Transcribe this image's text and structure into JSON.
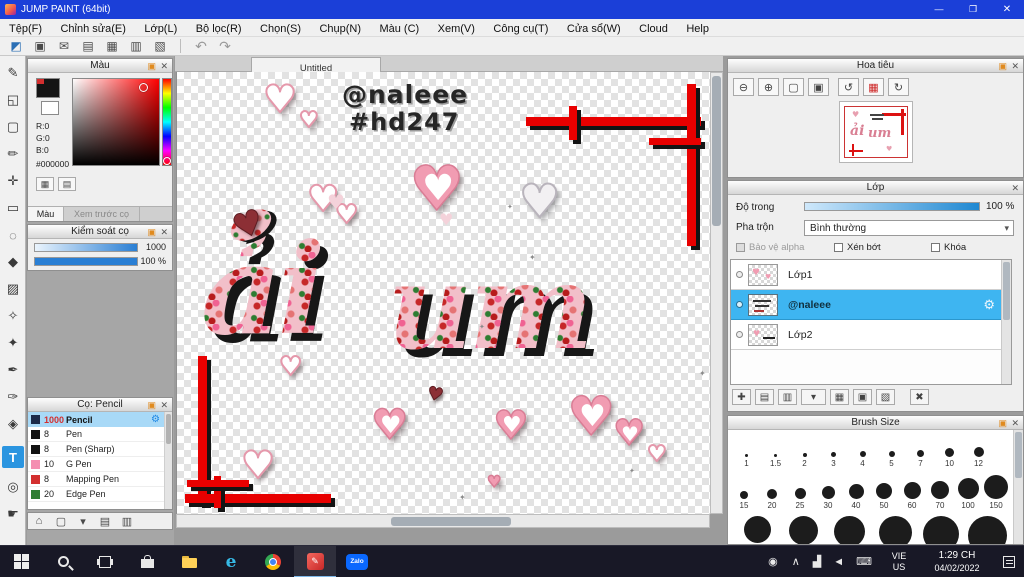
{
  "titlebar": {
    "title": "JUMP PAINT (64bit)",
    "minimize": "—",
    "restore": "❐",
    "close": "✕"
  },
  "menubar": {
    "items": [
      "Tệp(F)",
      "Chỉnh sửa(E)",
      "Lớp(L)",
      "Bộ lọc(R)",
      "Chọn(S)",
      "Chụp(N)",
      "Màu (C)",
      "Xem(V)",
      "Công cụ(T)",
      "Cửa sổ(W)",
      "Cloud",
      "Help"
    ]
  },
  "toolbar": {
    "icons": [
      {
        "name": "select-icon",
        "glyph": "◩"
      },
      {
        "name": "export-icon",
        "glyph": "▣"
      },
      {
        "name": "comment-icon",
        "glyph": "✉"
      },
      {
        "name": "paste-icon",
        "glyph": "▤"
      },
      {
        "name": "grid-icon",
        "glyph": "▦"
      },
      {
        "name": "table-icon",
        "glyph": "▥"
      },
      {
        "name": "cells-icon",
        "glyph": "▧"
      },
      {
        "name": "undo-icon",
        "glyph": "↶"
      },
      {
        "name": "redo-icon",
        "glyph": "↷"
      }
    ]
  },
  "tools": {
    "items": [
      {
        "name": "pen-tool",
        "glyph": "✎"
      },
      {
        "name": "eraser-tool",
        "glyph": "◱"
      },
      {
        "name": "shape-tool",
        "glyph": "▢"
      },
      {
        "name": "pencil-tool",
        "glyph": "✏"
      },
      {
        "name": "move-tool",
        "glyph": "✛"
      },
      {
        "name": "marquee-tool",
        "glyph": "▭"
      },
      {
        "name": "lasso-tool",
        "glyph": "◌"
      },
      {
        "name": "fill-tool",
        "glyph": "◆"
      },
      {
        "name": "gradient-tool",
        "glyph": "▨"
      },
      {
        "name": "dodge-tool",
        "glyph": "✧"
      },
      {
        "name": "wand-tool",
        "glyph": "✦"
      },
      {
        "name": "pen-nib-tool",
        "glyph": "✒"
      },
      {
        "name": "eyedropper-tool",
        "glyph": "✑"
      },
      {
        "name": "stamp-tool",
        "glyph": "◈"
      },
      {
        "name": "text-tool",
        "glyph": "T"
      },
      {
        "name": "zoom-tool",
        "glyph": "◎"
      },
      {
        "name": "hand-tool",
        "glyph": "☛"
      }
    ]
  },
  "panel_icons": {
    "dock": "▣",
    "close": "✕"
  },
  "color_panel": {
    "title": "Màu",
    "r": "R:0",
    "g": "G:0",
    "b": "B:0",
    "hex": "#000000",
    "tab_color": "Màu",
    "tab_preview": "Xem trước cọ"
  },
  "brush_control": {
    "title": "Kiểm soát cọ",
    "size_value": "1000",
    "opacity_value": "100 %"
  },
  "brush_panel": {
    "title": "Cọ: Pencil",
    "gear": "⚙",
    "brushes": [
      {
        "size": "1000",
        "name": "Pencil"
      },
      {
        "size": "8",
        "name": "Pen"
      },
      {
        "size": "8",
        "name": "Pen (Sharp)"
      },
      {
        "size": "10",
        "name": "G Pen"
      },
      {
        "size": "8",
        "name": "Mapping Pen"
      },
      {
        "size": "20",
        "name": "Edge Pen"
      }
    ]
  },
  "panel_footer": {
    "icons": [
      {
        "name": "home-button",
        "glyph": "⌂"
      },
      {
        "name": "new-page-button",
        "glyph": "▢"
      },
      {
        "name": "page-menu-button",
        "glyph": "▾"
      },
      {
        "name": "pages-button",
        "glyph": "▤"
      },
      {
        "name": "folder-button",
        "glyph": "▥"
      }
    ]
  },
  "canvas": {
    "tab": "Untitled",
    "handle": "@naleee",
    "hashtag": "#hd247",
    "script1": "ải",
    "script2": "um",
    "heart": "♥",
    "sparkle": "✦"
  },
  "navigator": {
    "title": "Hoa tiêu",
    "buttons": [
      {
        "name": "zoom-out-button",
        "glyph": "⊖"
      },
      {
        "name": "zoom-in-button",
        "glyph": "⊕"
      },
      {
        "name": "fit-view-button",
        "glyph": "▢"
      },
      {
        "name": "actual-size-button",
        "glyph": "▣"
      },
      {
        "name": "rotate-left-button",
        "glyph": "↺"
      },
      {
        "name": "frame-button",
        "glyph": "▦"
      },
      {
        "name": "rotate-right-button",
        "glyph": "↻"
      }
    ]
  },
  "layer_panel": {
    "title": "Lớp",
    "opacity_label": "Độ trong",
    "opacity_value": "100 %",
    "blend_label": "Pha trộn",
    "blend_value": "Bình thường",
    "blend_caret": "▾",
    "cb_alpha": "Bảo vệ alpha",
    "cb_clip": "Xén bớt",
    "cb_lock": "Khóa",
    "gear": "⚙",
    "layers": [
      {
        "name": "Lớp1"
      },
      {
        "name": "@naleee"
      },
      {
        "name": "Lớp2"
      }
    ],
    "buttons": [
      {
        "name": "add-layer-button",
        "glyph": "✚"
      },
      {
        "name": "new-page-layer-button",
        "glyph": "▤"
      },
      {
        "name": "duplicate-layer-button",
        "glyph": "▥"
      },
      {
        "name": "layer-menu-button",
        "glyph": "▾"
      },
      {
        "name": "folder-layer-button",
        "glyph": "▦"
      },
      {
        "name": "merge-layer-button",
        "glyph": "▣"
      },
      {
        "name": "layer-settings-button",
        "glyph": "▧"
      },
      {
        "name": "delete-layer-button",
        "glyph": "✖"
      }
    ]
  },
  "brush_size_panel": {
    "title": "Brush Size",
    "row1": [
      "1",
      "1.5",
      "2",
      "3",
      "4",
      "5",
      "7",
      "10",
      "12"
    ],
    "row2": [
      "15",
      "20",
      "25",
      "30",
      "40",
      "50",
      "60",
      "70",
      "100",
      "150"
    ]
  },
  "taskbar": {
    "zalo_label": "Zalo",
    "edge_glyph": "e",
    "jump_glyph": "✎",
    "tray": [
      {
        "name": "people-icon",
        "glyph": "◉"
      },
      {
        "name": "chevron-up-icon",
        "glyph": "∧"
      },
      {
        "name": "network-icon",
        "glyph": "▟"
      },
      {
        "name": "volume-icon",
        "glyph": "◄"
      },
      {
        "name": "keyboard-icon",
        "glyph": "⌨"
      }
    ],
    "lang_top": "VIE",
    "lang_bottom": "US",
    "time": "1:29 CH",
    "date": "04/02/2022"
  }
}
